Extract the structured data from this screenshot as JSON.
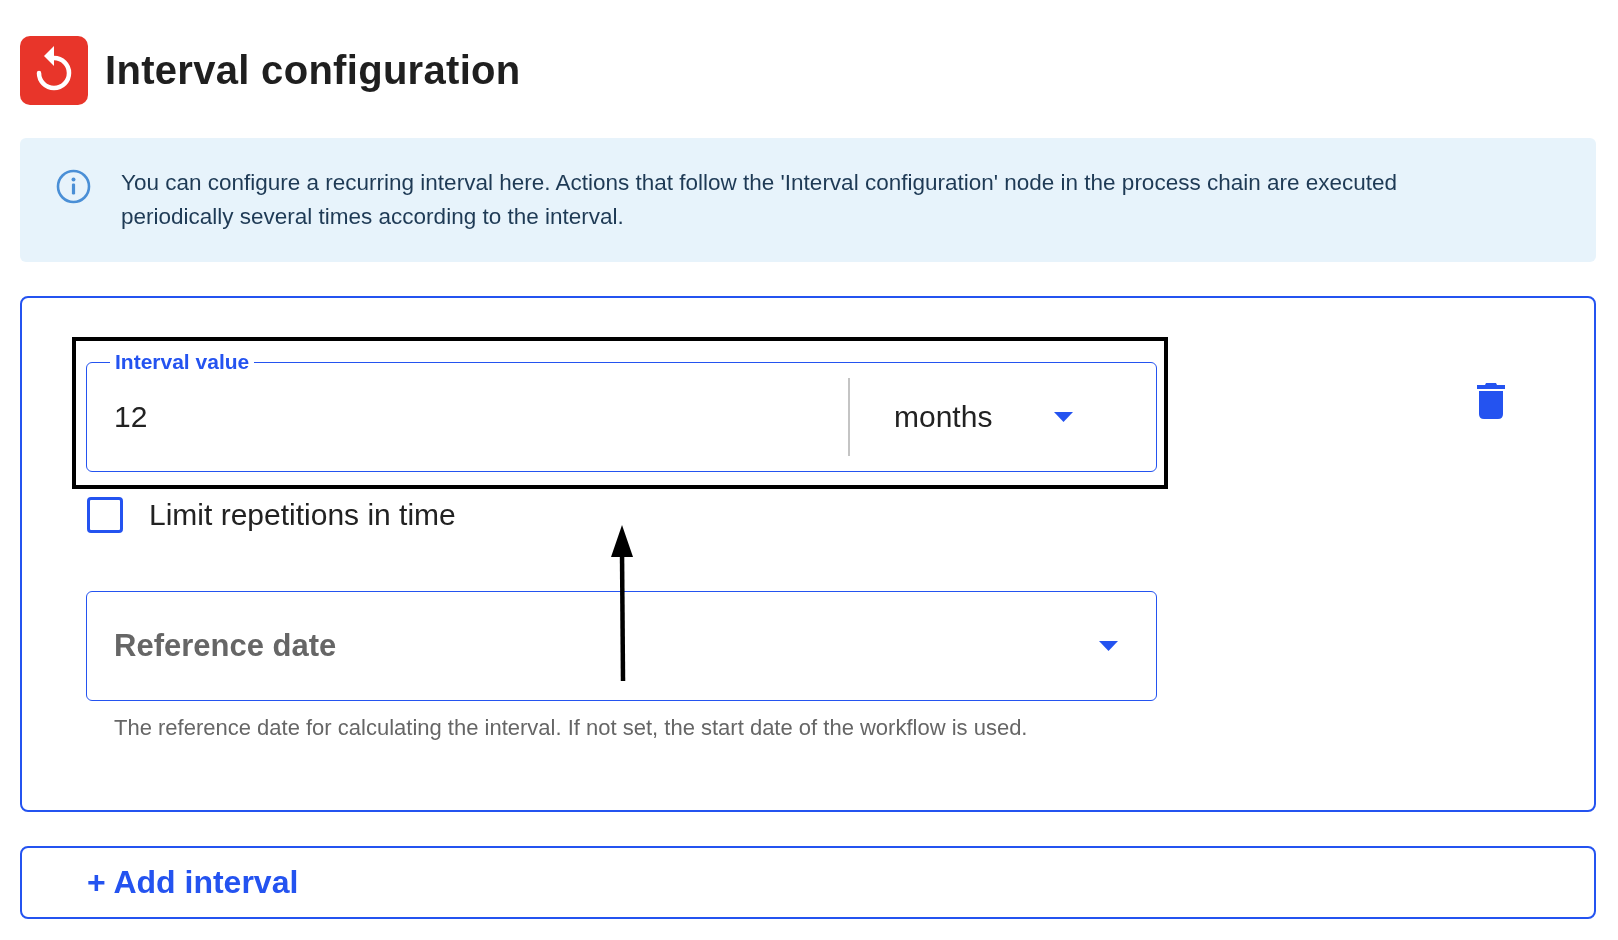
{
  "header": {
    "title": "Interval configuration"
  },
  "info": {
    "text": "You can configure a recurring interval here. Actions that follow the 'Interval configuration' node in the process chain are executed periodically several times according to the interval."
  },
  "interval_card": {
    "interval_value": {
      "label": "Interval value",
      "value": "12",
      "unit": "months"
    },
    "limit_repetitions": {
      "label": "Limit repetitions in time",
      "checked": false
    },
    "reference_date": {
      "label": "Reference date",
      "helper_text": "The reference date for calculating the interval. If not set, the start date of the workflow is used."
    }
  },
  "add_button": {
    "label": "+ Add interval"
  }
}
